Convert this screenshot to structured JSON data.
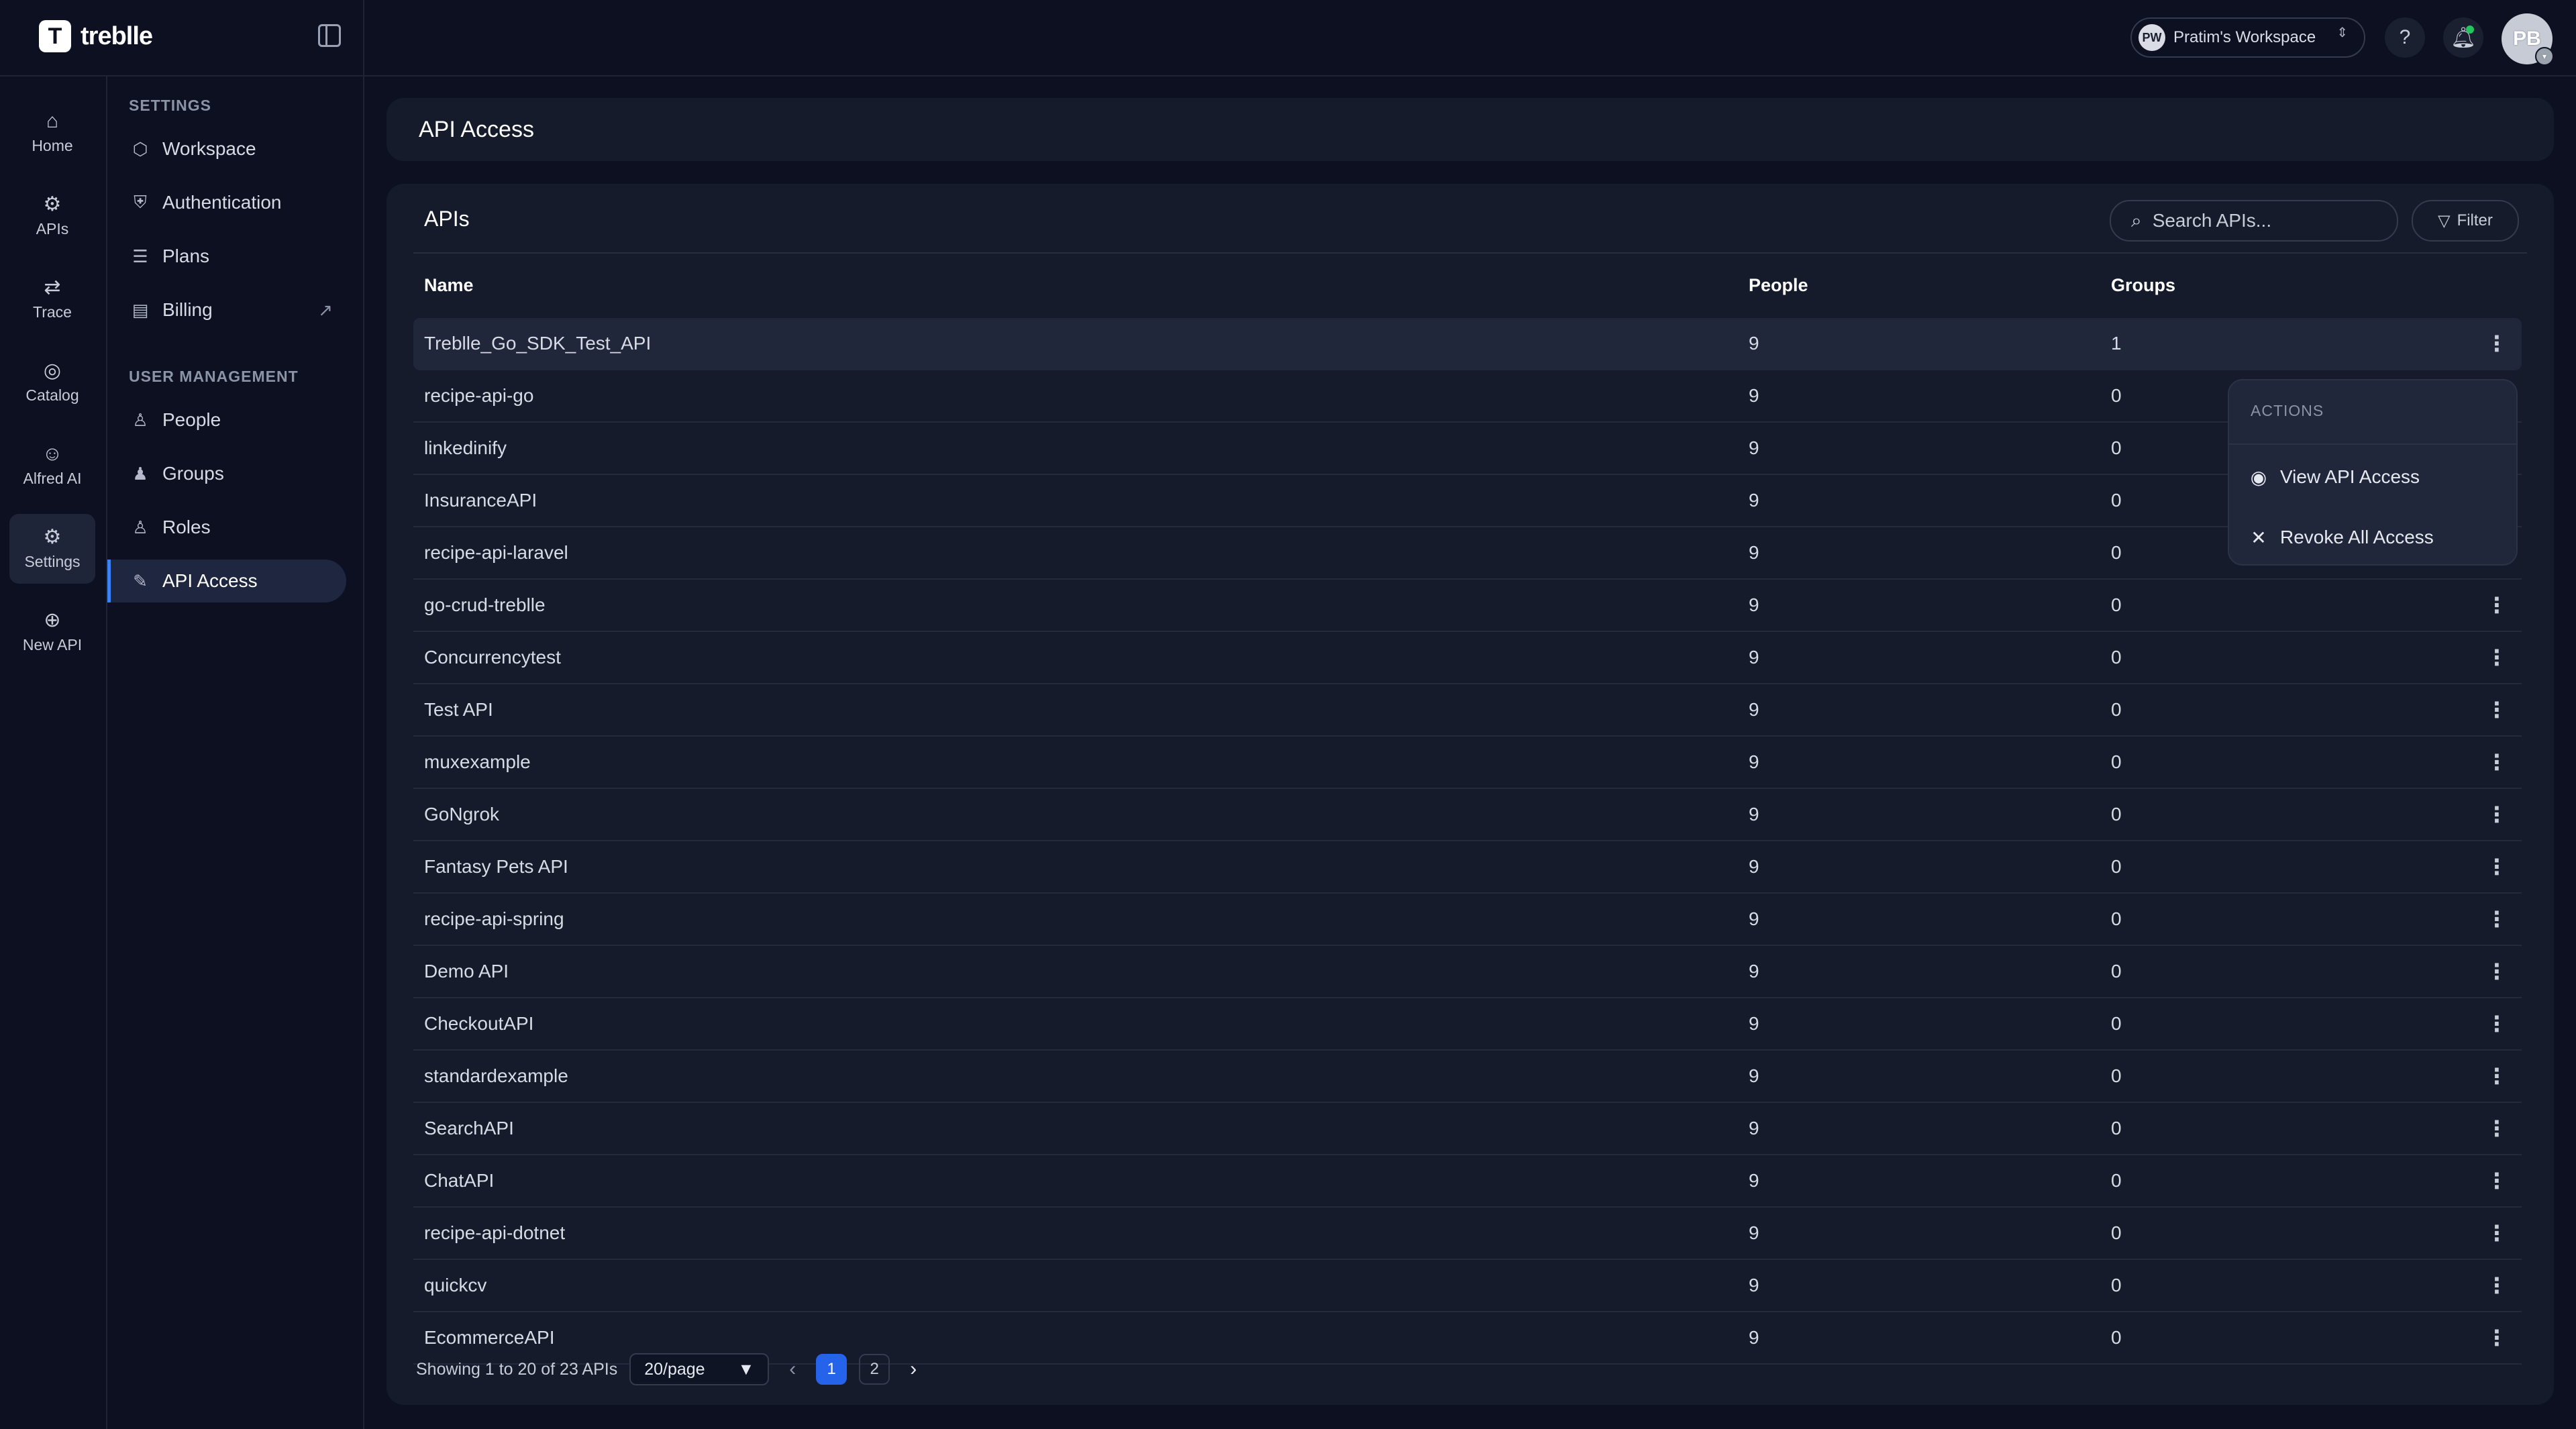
{
  "brand": {
    "name": "treblle",
    "mark": "T"
  },
  "workspace": {
    "initials": "PW",
    "name": "Pratim's Workspace",
    "caret": "⇕"
  },
  "header": {
    "help_label": "?",
    "user_initials": "PB"
  },
  "rail": [
    {
      "label": "Home",
      "icon": "⌂"
    },
    {
      "label": "APIs",
      "icon": "⚙"
    },
    {
      "label": "Trace",
      "icon": "⇄"
    },
    {
      "label": "Catalog",
      "icon": "◎"
    },
    {
      "label": "Alfred AI",
      "icon": "☺"
    },
    {
      "label": "Settings",
      "icon": "⚙"
    },
    {
      "label": "New API",
      "icon": "⊕"
    }
  ],
  "settings_nav": {
    "section1": "SETTINGS",
    "items1": [
      {
        "label": "Workspace",
        "icon": "⬡"
      },
      {
        "label": "Authentication",
        "icon": "⛨"
      },
      {
        "label": "Plans",
        "icon": "☰"
      },
      {
        "label": "Billing",
        "icon": "▤"
      }
    ],
    "billing_external": "↗",
    "section2": "USER MANAGEMENT",
    "items2": [
      {
        "label": "People",
        "icon": "♙"
      },
      {
        "label": "Groups",
        "icon": "♟"
      },
      {
        "label": "Roles",
        "icon": "♙"
      },
      {
        "label": "API Access",
        "icon": "✎"
      }
    ]
  },
  "page": {
    "title": "API Access"
  },
  "panel": {
    "title": "APIs",
    "search_placeholder": "Search APIs...",
    "filter_label": "Filter",
    "columns": {
      "name": "Name",
      "people": "People",
      "groups": "Groups"
    }
  },
  "rows": [
    {
      "name": "Treblle_Go_SDK_Test_API",
      "people": "9",
      "groups": "1"
    },
    {
      "name": "recipe-api-go",
      "people": "9",
      "groups": "0"
    },
    {
      "name": "linkedinify",
      "people": "9",
      "groups": "0"
    },
    {
      "name": "InsuranceAPI",
      "people": "9",
      "groups": "0"
    },
    {
      "name": "recipe-api-laravel",
      "people": "9",
      "groups": "0"
    },
    {
      "name": "go-crud-treblle",
      "people": "9",
      "groups": "0"
    },
    {
      "name": "Concurrencytest",
      "people": "9",
      "groups": "0"
    },
    {
      "name": "Test API",
      "people": "9",
      "groups": "0"
    },
    {
      "name": "muxexample",
      "people": "9",
      "groups": "0"
    },
    {
      "name": "GoNgrok",
      "people": "9",
      "groups": "0"
    },
    {
      "name": "Fantasy Pets API",
      "people": "9",
      "groups": "0"
    },
    {
      "name": "recipe-api-spring",
      "people": "9",
      "groups": "0"
    },
    {
      "name": "Demo API",
      "people": "9",
      "groups": "0"
    },
    {
      "name": "CheckoutAPI",
      "people": "9",
      "groups": "0"
    },
    {
      "name": "standardexample",
      "people": "9",
      "groups": "0"
    },
    {
      "name": "SearchAPI",
      "people": "9",
      "groups": "0"
    },
    {
      "name": "ChatAPI",
      "people": "9",
      "groups": "0"
    },
    {
      "name": "recipe-api-dotnet",
      "people": "9",
      "groups": "0"
    },
    {
      "name": "quickcv",
      "people": "9",
      "groups": "0"
    },
    {
      "name": "EcommerceAPI",
      "people": "9",
      "groups": "0"
    }
  ],
  "actions_menu": {
    "heading": "ACTIONS",
    "items": [
      {
        "label": "View API Access",
        "icon": "◉"
      },
      {
        "label": "Revoke All Access",
        "icon": "✕"
      }
    ]
  },
  "pagination": {
    "summary": "Showing 1 to 20 of 23 APIs",
    "page_size": "20/page",
    "page_size_caret": "▼",
    "prev": "‹",
    "next": "›",
    "pages": [
      "1",
      "2"
    ],
    "current": "1"
  },
  "colors": {
    "accent": "#2563eb",
    "background": "#0c1020",
    "surface": "#161b2b",
    "notification": "#22c55e"
  }
}
